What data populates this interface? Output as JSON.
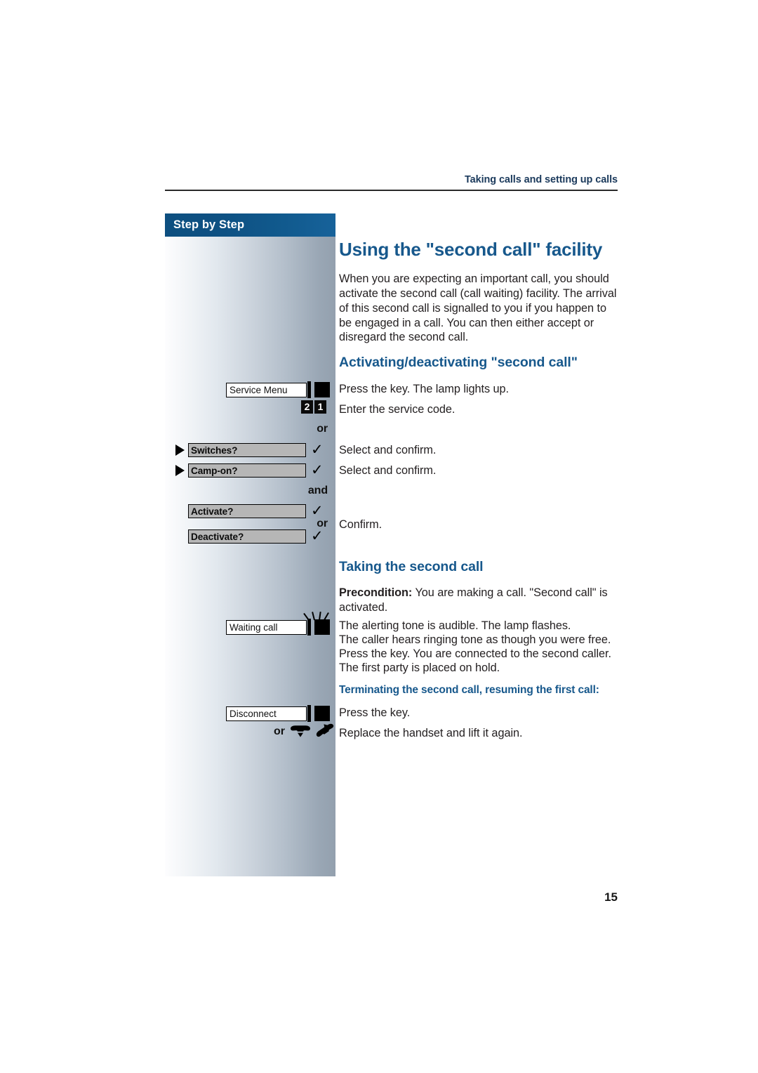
{
  "header": {
    "running_title": "Taking calls and setting up calls"
  },
  "sidebar": {
    "header_label": "Step by Step",
    "conjunctions": {
      "or_1": "or",
      "and_1": "and",
      "or_2": "or",
      "or_3": "or"
    },
    "function_keys": [
      {
        "label": "Service Menu",
        "lamp": "lamp-icon",
        "flashing": false
      },
      {
        "label": "Waiting call",
        "lamp": "lamp-icon",
        "flashing": true
      },
      {
        "label": "Disconnect",
        "lamp": "lamp-icon",
        "flashing": false
      }
    ],
    "keypad_entry": {
      "digits": [
        "2",
        "1"
      ]
    },
    "options": [
      {
        "label": "Switches?",
        "arrow": true,
        "confirm": "✓"
      },
      {
        "label": "Camp-on?",
        "arrow": true,
        "confirm": "✓"
      },
      {
        "label": "Activate?",
        "arrow": false,
        "confirm": "✓"
      },
      {
        "label": "Deactivate?",
        "arrow": false,
        "confirm": "✓"
      }
    ],
    "handset_row": {
      "or_label": "or",
      "icons": [
        "replace-handset-icon",
        "lift-handset-icon"
      ]
    }
  },
  "content": {
    "title": "Using the \"second call\" facility",
    "intro": "When you are expecting an important call, you should activate the second call (call waiting) facility. The arrival of this second call is signalled to you if you happen to be engaged in a call. You can then either accept or disregard the second call.",
    "section_1": {
      "heading": "Activating/deactivating \"second call\"",
      "steps": [
        "Press the key. The lamp lights up.",
        "Enter the service code.",
        "Select and confirm.",
        "Select and confirm.",
        "Confirm."
      ]
    },
    "section_2": {
      "heading": "Taking the second call",
      "precondition_label": "Precondition:",
      "precondition_text": " You are making a call. \"Second call\" is activated.",
      "lines": [
        "The alerting tone is audible. The lamp flashes.",
        "The caller hears ringing tone as though you were free.",
        "Press the key. You are connected to the second caller.",
        "The first party is placed on hold."
      ],
      "minor_heading": "Terminating the second call, resuming the first call:",
      "steps": [
        "Press the key.",
        "Replace the handset and lift it again."
      ]
    }
  },
  "footer": {
    "page_number": "15"
  },
  "colors": {
    "brand_blue": "#17588c",
    "header_bar": "#0d4f80",
    "text": "#231f20"
  }
}
